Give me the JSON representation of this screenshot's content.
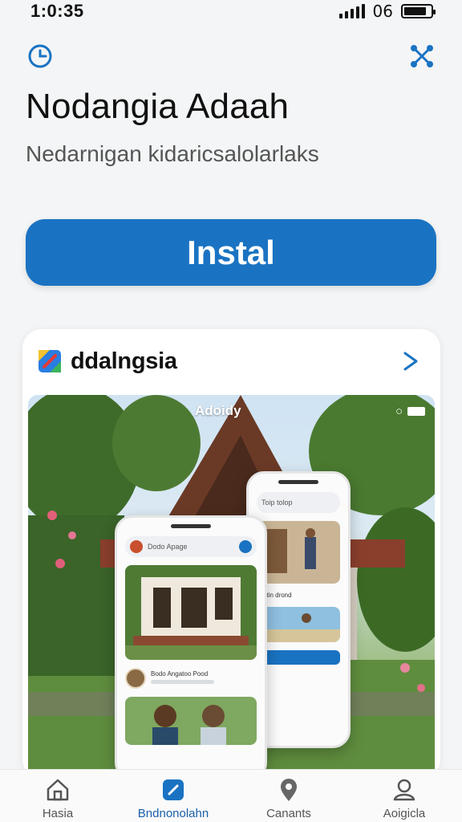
{
  "status_bar": {
    "time": "1:0:35",
    "network": "06",
    "battery_level": 0.85
  },
  "top_icons": {
    "left": "clock-icon",
    "right": "share-icon"
  },
  "app": {
    "title": "Nodangia Adaah",
    "subtitle": "Nedarnigan kidaricsalolarlaks",
    "install_label": "Instal"
  },
  "preview": {
    "title": "ddalngsia",
    "badge": "Adoidy",
    "back_phone_text": "Toip tolop",
    "back_phone_row": "Rettin drond",
    "front_phone_search": "Dodo Apage",
    "front_phone_row": "Bodo Angatoo Pood"
  },
  "colors": {
    "accent": "#1a73c2",
    "tab_active": "#1a5fa8"
  },
  "tabs": [
    {
      "label": "Hasia",
      "icon": "home-icon",
      "active": false
    },
    {
      "label": "Bndnonolahn",
      "icon": "shield-icon",
      "active": true
    },
    {
      "label": "Canants",
      "icon": "location-pin-icon",
      "active": false
    },
    {
      "label": "Aoigicla",
      "icon": "profile-icon",
      "active": false
    }
  ]
}
